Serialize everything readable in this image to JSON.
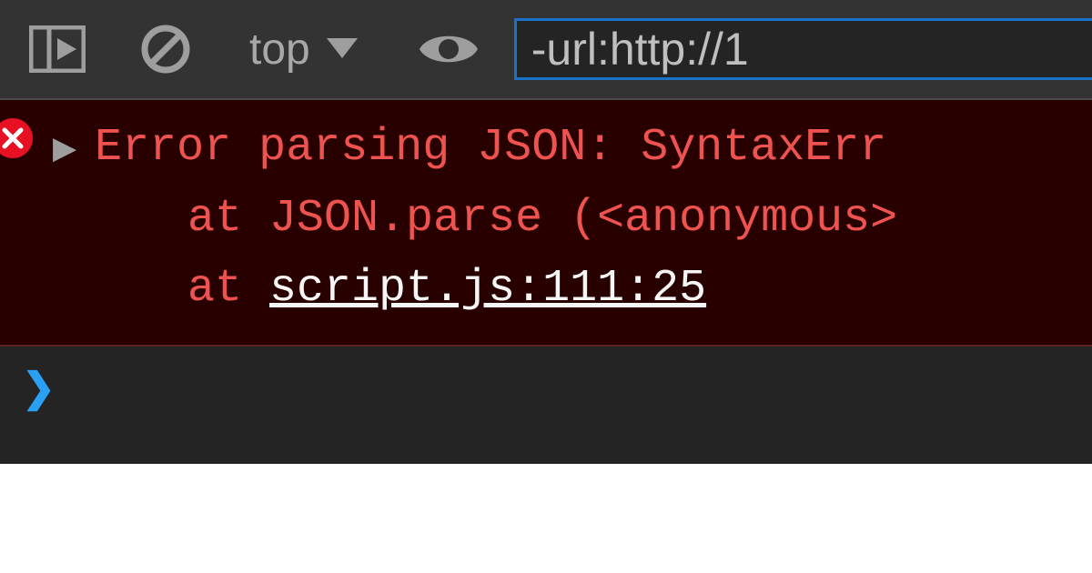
{
  "toolbar": {
    "context_label": "top",
    "filter_value": "-url:http://1"
  },
  "error": {
    "message": "Error parsing JSON: SyntaxErr",
    "stack1_prefix": "   at JSON.parse (",
    "stack1_anon": "<anonymous>",
    "stack2_prefix": "   at ",
    "stack2_loc": "script.js:111:25"
  }
}
